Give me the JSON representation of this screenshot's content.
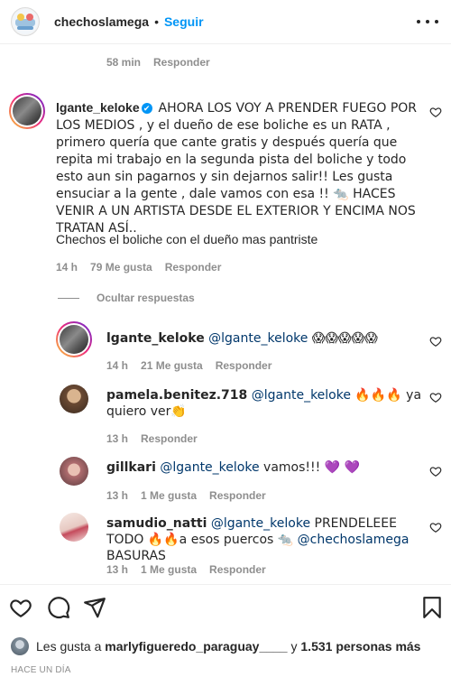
{
  "header": {
    "username": "chechoslamega",
    "separator": "•",
    "follow_label": "Seguir"
  },
  "prev_comment": {
    "time": "58 min",
    "reply": "Responder"
  },
  "main_comment": {
    "username": "lgante_keloke",
    "verified_icon": "✔",
    "text": "AHORA LOS VOY A PRENDER FUEGO POR LOS MEDIOS , y el dueño de ese boliche es un RATA , primero quería que cante gratis y después quería que repita mi trabajo en la segunda pista del boliche y todo esto aun sin pagarnos y sin dejarnos salir!! Les gusta ensuciar a la gente , dale vamos con esa !! 🐀 HACES VENIR A UN ARTISTA DESDE EL EXTERIOR Y ENCIMA NOS TRATAN ASÍ..",
    "text2": "Chechos el boliche con el dueño mas pantriste",
    "time": "14 h",
    "likes": "79 Me gusta",
    "reply": "Responder"
  },
  "hide_replies": "Ocultar respuestas",
  "replies": [
    {
      "username": "lgante_keloke",
      "mention": "@lgante_keloke",
      "text": "😱😱😱😱😱",
      "time": "14 h",
      "likes": "21 Me gusta",
      "reply": "Responder"
    },
    {
      "username": "pamela.benitez.718",
      "mention": "@lgante_keloke",
      "text": "🔥🔥🔥 ya quiero ver👏",
      "time": "13 h",
      "likes": "",
      "reply": "Responder"
    },
    {
      "username": "gillkari",
      "mention": "@lgante_keloke",
      "text": "vamos!!! 💜 💜",
      "time": "13 h",
      "likes": "1 Me gusta",
      "reply": "Responder"
    },
    {
      "username": "samudio_natti",
      "mention": "@lgante_keloke",
      "text": "PRENDELEEE TODO 🔥🔥a esos puercos 🐀",
      "mention2": "@chechoslamega",
      "text2": "BASURAS",
      "time": "13 h",
      "likes": "1 Me gusta",
      "reply": "Responder"
    }
  ],
  "actions": {
    "like_icon": "heart-icon",
    "comment_icon": "comment-icon",
    "share_icon": "share-icon",
    "save_icon": "bookmark-icon"
  },
  "likes_summary": {
    "prefix": "Les gusta a",
    "user": "marlyfigueredo_paraguay____",
    "middle": "y",
    "others": "1.531 personas más"
  },
  "posted_ago": "HACE UN DÍA"
}
